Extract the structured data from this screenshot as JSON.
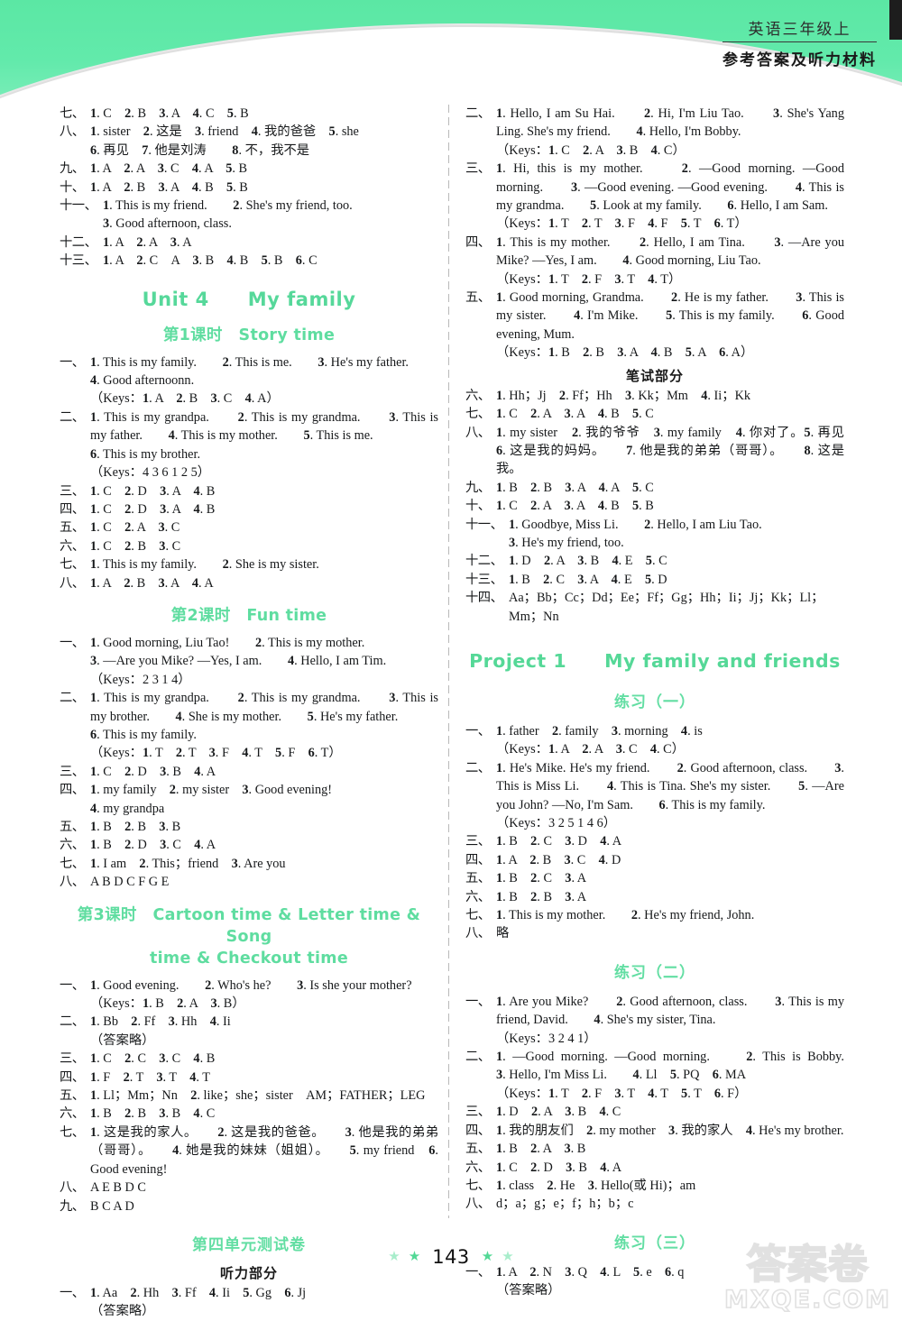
{
  "header": {
    "subject_grade": "英语三年级上",
    "doc_type": "参考答案及听力材料"
  },
  "footer": {
    "page_number": "143",
    "star_glyph": "★"
  },
  "watermark": {
    "line1": "答案卷",
    "line2": "MXQE.COM"
  },
  "left_column": {
    "blocks": [
      {
        "type": "answer",
        "num": "七、",
        "body": "<b>1</b>. C　<b>2</b>. B　<b>3</b>. A　<b>4</b>. C　<b>5</b>. B"
      },
      {
        "type": "answer",
        "num": "八、",
        "body": "<b>1</b>. sister　<b>2</b>. 这是　<b>3</b>. friend　<b>4</b>. 我的爸爸　<b>5</b>. she"
      },
      {
        "type": "indent",
        "body": "<b>6</b>. 再见　<b>7</b>. 他是刘涛　　<b>8</b>. 不，我不是"
      },
      {
        "type": "answer",
        "num": "九、",
        "body": "<b>1</b>. A　<b>2</b>. A　<b>3</b>. C　<b>4</b>. A　<b>5</b>. B"
      },
      {
        "type": "answer",
        "num": "十、",
        "body": "<b>1</b>. A　<b>2</b>. B　<b>3</b>. A　<b>4</b>. B　<b>5</b>. B"
      },
      {
        "type": "answer_wide",
        "num": "十一、",
        "body": "<b>1</b>. This is my friend.　　<b>2</b>. She's my friend, too."
      },
      {
        "type": "indent_wide",
        "body": "<b>3</b>. Good afternoon, class."
      },
      {
        "type": "answer_wide",
        "num": "十二、",
        "body": "<b>1</b>. A　<b>2</b>. A　<b>3</b>. A"
      },
      {
        "type": "answer_wide",
        "num": "十三、",
        "body": "<b>1</b>. A　<b>2</b>. C　A　<b>3</b>. B　<b>4</b>. B　<b>5</b>. B　<b>6</b>. C"
      },
      {
        "type": "h-unit",
        "body": "Unit 4　　My family"
      },
      {
        "type": "h-lesson",
        "body": "第1课时　Story time"
      },
      {
        "type": "answer",
        "num": "一、",
        "body": "<b>1</b>. This is my family.　　<b>2</b>. This is me.　　<b>3</b>. He's my father."
      },
      {
        "type": "indent",
        "body": "<b>4</b>. Good afternoonn."
      },
      {
        "type": "indent",
        "body": "（Keys：<b>1</b>. A　<b>2</b>. B　<b>3</b>. C　<b>4</b>. A）"
      },
      {
        "type": "answer",
        "num": "二、",
        "body": "<b>1</b>. This is my grandpa.　　<b>2</b>. This is my grandma.　　<b>3</b>. This is my father.　　<b>4</b>. This is my mother.　　<b>5</b>. This is me."
      },
      {
        "type": "indent",
        "body": "<b>6</b>. This is my brother."
      },
      {
        "type": "indent",
        "body": "（Keys：4 3 6 1 2 5）"
      },
      {
        "type": "answer",
        "num": "三、",
        "body": "<b>1</b>. C　<b>2</b>. D　<b>3</b>. A　<b>4</b>. B"
      },
      {
        "type": "answer",
        "num": "四、",
        "body": "<b>1</b>. C　<b>2</b>. D　<b>3</b>. A　<b>4</b>. B"
      },
      {
        "type": "answer",
        "num": "五、",
        "body": "<b>1</b>. C　<b>2</b>. A　<b>3</b>. C"
      },
      {
        "type": "answer",
        "num": "六、",
        "body": "<b>1</b>. C　<b>2</b>. B　<b>3</b>. C"
      },
      {
        "type": "answer",
        "num": "七、",
        "body": "<b>1</b>. This is my family.　　<b>2</b>. She is my sister."
      },
      {
        "type": "answer",
        "num": "八、",
        "body": "<b>1</b>. A　<b>2</b>. B　<b>3</b>. A　<b>4</b>. A"
      },
      {
        "type": "h-lesson",
        "body": "第2课时　Fun time"
      },
      {
        "type": "answer",
        "num": "一、",
        "body": "<b>1</b>. Good morning, Liu Tao!　　<b>2</b>. This is my mother."
      },
      {
        "type": "indent",
        "body": "<b>3</b>. —Are you Mike? —Yes, I am.　　<b>4</b>. Hello, I am Tim."
      },
      {
        "type": "indent",
        "body": "（Keys：2 3 1 4）"
      },
      {
        "type": "answer",
        "num": "二、",
        "body": "<b>1</b>. This is my grandpa.　　<b>2</b>. This is my grandma.　　<b>3</b>. This is my brother.　　<b>4</b>. She is my mother.　　<b>5</b>. He's my father."
      },
      {
        "type": "indent",
        "body": "<b>6</b>. This is my family."
      },
      {
        "type": "indent",
        "body": "（Keys：<b>1</b>. T　<b>2</b>. T　<b>3</b>. F　<b>4</b>. T　<b>5</b>. F　<b>6</b>. T）"
      },
      {
        "type": "answer",
        "num": "三、",
        "body": "<b>1</b>. C　<b>2</b>. D　<b>3</b>. B　<b>4</b>. A"
      },
      {
        "type": "answer",
        "num": "四、",
        "body": "<b>1</b>. my family　<b>2</b>. my sister　<b>3</b>. Good evening!"
      },
      {
        "type": "indent",
        "body": "<b>4</b>. my grandpa"
      },
      {
        "type": "answer",
        "num": "五、",
        "body": "<b>1</b>. B　<b>2</b>. B　<b>3</b>. B"
      },
      {
        "type": "answer",
        "num": "六、",
        "body": "<b>1</b>. B　<b>2</b>. D　<b>3</b>. C　<b>4</b>. A"
      },
      {
        "type": "answer",
        "num": "七、",
        "body": "<b>1</b>. I am　<b>2</b>. This；friend　<b>3</b>. Are you"
      },
      {
        "type": "answer",
        "num": "八、",
        "body": "A B D C F G E"
      },
      {
        "type": "h-lesson2",
        "body": "第3课时　Cartoon time &amp; Letter time &amp; Song",
        "body2": "time &amp; Checkout time"
      },
      {
        "type": "answer",
        "num": "一、",
        "body": "<b>1</b>. Good evening.　　<b>2</b>. Who's he?　　<b>3</b>. Is she your mother?"
      },
      {
        "type": "indent",
        "body": "（Keys：<b>1</b>. B　<b>2</b>. A　<b>3</b>. B）"
      },
      {
        "type": "answer",
        "num": "二、",
        "body": "<b>1</b>. Bb　<b>2</b>. Ff　<b>3</b>. Hh　<b>4</b>. Ii"
      },
      {
        "type": "indent",
        "body": "（答案略）"
      },
      {
        "type": "answer",
        "num": "三、",
        "body": "<b>1</b>. C　<b>2</b>. C　<b>3</b>. C　<b>4</b>. B"
      },
      {
        "type": "answer",
        "num": "四、",
        "body": "<b>1</b>. F　<b>2</b>. T　<b>3</b>. T　<b>4</b>. T"
      },
      {
        "type": "answer",
        "num": "五、",
        "body": "<b>1</b>. Ll；Mm；Nn　<b>2</b>. like；she；sister　AM；FATHER；LEG"
      },
      {
        "type": "answer",
        "num": "六、",
        "body": "<b>1</b>. B　<b>2</b>. B　<b>3</b>. B　<b>4</b>. C"
      },
      {
        "type": "answer",
        "num": "七、",
        "body": "<b>1</b>. 这是我的家人。　　<b>2</b>. 这是我的爸爸。　　<b>3</b>. 他是我的弟弟（哥哥）。　　<b>4</b>. 她是我的妹妹（姐姐）。　　<b>5</b>. my friend　<b>6</b>. Good evening!"
      },
      {
        "type": "answer",
        "num": "八、",
        "body": "A E B D C"
      },
      {
        "type": "answer",
        "num": "九、",
        "body": "B C A D"
      },
      {
        "type": "h-test",
        "body": "第四单元测试卷"
      },
      {
        "type": "h-section",
        "body": "听力部分"
      },
      {
        "type": "answer",
        "num": "一、",
        "body": "<b>1</b>. Aa　<b>2</b>. Hh　<b>3</b>. Ff　<b>4</b>. Ii　<b>5</b>. Gg　<b>6</b>. Jj"
      },
      {
        "type": "indent",
        "body": "（答案略）"
      }
    ]
  },
  "right_column": {
    "blocks": [
      {
        "type": "answer",
        "num": "二、",
        "body": "<b>1</b>. Hello, I am Su Hai.　　<b>2</b>. Hi, I'm Liu Tao.　　<b>3</b>. She's Yang Ling. She's my friend.　　<b>4</b>. Hello, I'm Bobby."
      },
      {
        "type": "indent",
        "body": "（Keys：<b>1</b>. C　<b>2</b>. A　<b>3</b>. B　<b>4</b>. C）"
      },
      {
        "type": "answer",
        "num": "三、",
        "body": "<b>1</b>. Hi, this is my mother.　　<b>2</b>. —Good morning. —Good morning.　　<b>3</b>. —Good evening. —Good evening.　　<b>4</b>. This is my grandma.　　<b>5</b>. Look at my family.　　<b>6</b>. Hello, I am Sam."
      },
      {
        "type": "indent",
        "body": "（Keys：<b>1</b>. T　<b>2</b>. T　<b>3</b>. F　<b>4</b>. F　<b>5</b>. T　<b>6</b>. T）"
      },
      {
        "type": "answer",
        "num": "四、",
        "body": "<b>1</b>. This is my mother.　　<b>2</b>. Hello, I am Tina.　　<b>3</b>. —Are you Mike? —Yes, I am.　　<b>4</b>. Good morning, Liu Tao."
      },
      {
        "type": "indent",
        "body": "（Keys：<b>1</b>. T　<b>2</b>. F　<b>3</b>. T　<b>4</b>. T）"
      },
      {
        "type": "answer",
        "num": "五、",
        "body": "<b>1</b>. Good morning, Grandma.　　<b>2</b>. He is my father.　　<b>3</b>. This is my sister.　　<b>4</b>. I'm Mike.　　<b>5</b>. This is my family.　　<b>6</b>. Good evening, Mum."
      },
      {
        "type": "indent",
        "body": "（Keys：<b>1</b>. B　<b>2</b>. B　<b>3</b>. A　<b>4</b>. B　<b>5</b>. A　<b>6</b>. A）"
      },
      {
        "type": "h-section",
        "body": "笔试部分"
      },
      {
        "type": "answer",
        "num": "六、",
        "body": "<b>1</b>. Hh；Jj　<b>2</b>. Ff；Hh　<b>3</b>. Kk；Mm　<b>4</b>. Ii；Kk"
      },
      {
        "type": "answer",
        "num": "七、",
        "body": "<b>1</b>. C　<b>2</b>. A　<b>3</b>. A　<b>4</b>. B　<b>5</b>. C"
      },
      {
        "type": "answer",
        "num": "八、",
        "body": "<b>1</b>. my sister　<b>2</b>. 我的爷爷　<b>3</b>. my family　<b>4</b>. 你对了。<b>5</b>. 再见　<b>6</b>. 这是我的妈妈。　　<b>7</b>. 他是我的弟弟（哥哥）。　　<b>8</b>. 这是我。"
      },
      {
        "type": "answer",
        "num": "九、",
        "body": "<b>1</b>. B　<b>2</b>. B　<b>3</b>. A　<b>4</b>. A　<b>5</b>. C"
      },
      {
        "type": "answer",
        "num": "十、",
        "body": "<b>1</b>. C　<b>2</b>. A　<b>3</b>. A　<b>4</b>. B　<b>5</b>. B"
      },
      {
        "type": "answer_wide",
        "num": "十一、",
        "body": "<b>1</b>. Goodbye, Miss Li.　　<b>2</b>. Hello, I am Liu Tao."
      },
      {
        "type": "indent_wide",
        "body": "<b>3</b>. He's my friend, too."
      },
      {
        "type": "answer_wide",
        "num": "十二、",
        "body": "<b>1</b>. D　<b>2</b>. A　<b>3</b>. B　<b>4</b>. E　<b>5</b>. C"
      },
      {
        "type": "answer_wide",
        "num": "十三、",
        "body": "<b>1</b>. B　<b>2</b>. C　<b>3</b>. A　<b>4</b>. E　<b>5</b>. D"
      },
      {
        "type": "answer_wide",
        "num": "十四、",
        "body": "Aa；Bb；Cc；Dd；Ee；Ff；Gg；Hh；Ii；Jj；Kk；Ll；Mm；Nn"
      },
      {
        "type": "h-project",
        "body": "Project 1　　My family and friends"
      },
      {
        "type": "h-practice",
        "body": "练习（一）"
      },
      {
        "type": "answer",
        "num": "一、",
        "body": "<b>1</b>. father　<b>2</b>. family　<b>3</b>. morning　<b>4</b>. is"
      },
      {
        "type": "indent",
        "body": "（Keys：<b>1</b>. A　<b>2</b>. A　<b>3</b>. C　<b>4</b>. C）"
      },
      {
        "type": "answer",
        "num": "二、",
        "body": "<b>1</b>. He's Mike. He's my friend.　　<b>2</b>. Good afternoon, class.　　<b>3</b>. This is Miss Li.　　<b>4</b>. This is Tina. She's my sister.　　<b>5</b>. —Are you John? —No, I'm Sam.　　<b>6</b>. This is my family."
      },
      {
        "type": "indent",
        "body": "（Keys：3 2 5 1 4 6）"
      },
      {
        "type": "answer",
        "num": "三、",
        "body": "<b>1</b>. B　<b>2</b>. C　<b>3</b>. D　<b>4</b>. A"
      },
      {
        "type": "answer",
        "num": "四、",
        "body": "<b>1</b>. A　<b>2</b>. B　<b>3</b>. C　<b>4</b>. D"
      },
      {
        "type": "answer",
        "num": "五、",
        "body": "<b>1</b>. B　<b>2</b>. C　<b>3</b>. A"
      },
      {
        "type": "answer",
        "num": "六、",
        "body": "<b>1</b>. B　<b>2</b>. B　<b>3</b>. A"
      },
      {
        "type": "answer",
        "num": "七、",
        "body": "<b>1</b>. This is my mother.　　<b>2</b>. He's my friend, John."
      },
      {
        "type": "answer",
        "num": "八、",
        "body": "略"
      },
      {
        "type": "h-practice",
        "body": "练习（二）"
      },
      {
        "type": "answer",
        "num": "一、",
        "body": "<b>1</b>. Are you Mike?　　<b>2</b>. Good afternoon, class.　　<b>3</b>. This is my friend, David.　　<b>4</b>. She's my sister, Tina."
      },
      {
        "type": "indent",
        "body": "（Keys：3 2 4 1）"
      },
      {
        "type": "answer",
        "num": "二、",
        "body": "<b>1</b>. —Good morning. —Good morning.　　<b>2</b>. This is Bobby.　　<b>3</b>. Hello, I'm Miss Li.　　<b>4</b>. Ll　<b>5</b>. PQ　<b>6</b>. MA"
      },
      {
        "type": "indent",
        "body": "（Keys：<b>1</b>. T　<b>2</b>. F　<b>3</b>. T　<b>4</b>. T　<b>5</b>. T　<b>6</b>. F）"
      },
      {
        "type": "answer",
        "num": "三、",
        "body": "<b>1</b>. D　<b>2</b>. A　<b>3</b>. B　<b>4</b>. C"
      },
      {
        "type": "answer",
        "num": "四、",
        "body": "<b>1</b>. 我的朋友们　<b>2</b>. my mother　<b>3</b>. 我的家人　<b>4</b>. He's my brother."
      },
      {
        "type": "answer",
        "num": "五、",
        "body": "<b>1</b>. B　<b>2</b>. A　<b>3</b>. B"
      },
      {
        "type": "answer",
        "num": "六、",
        "body": "<b>1</b>. C　<b>2</b>. D　<b>3</b>. B　<b>4</b>. A"
      },
      {
        "type": "answer",
        "num": "七、",
        "body": "<b>1</b>. class　<b>2</b>. He　<b>3</b>. Hello(或 Hi)；am"
      },
      {
        "type": "answer",
        "num": "八、",
        "body": "d；a；g；e；f；h；b；c"
      },
      {
        "type": "h-practice",
        "body": "练习（三）"
      },
      {
        "type": "answer",
        "num": "一、",
        "body": "<b>1</b>. A　<b>2</b>. N　<b>3</b>. Q　<b>4</b>. L　<b>5</b>. e　<b>6</b>. q"
      },
      {
        "type": "indent",
        "body": "（答案略）"
      }
    ]
  }
}
